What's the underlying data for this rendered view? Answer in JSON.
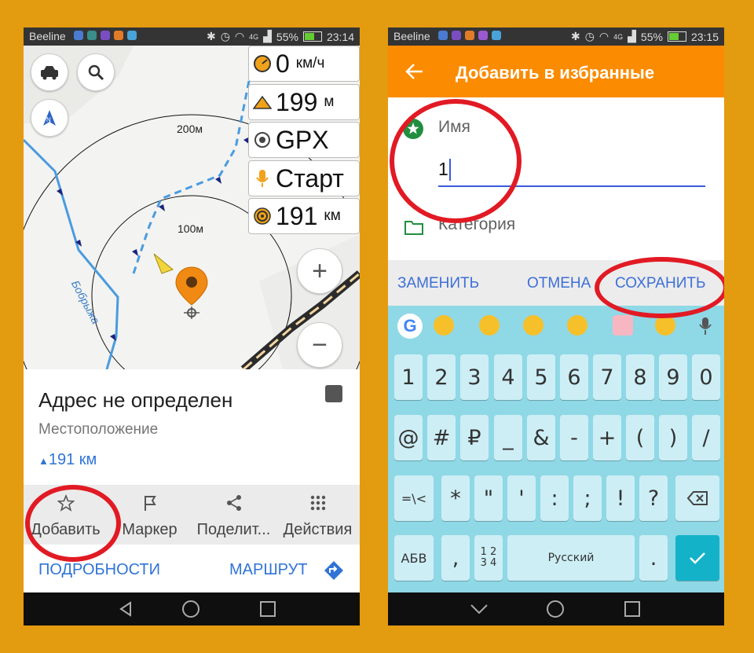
{
  "left_screen": {
    "status": {
      "carrier": "Beeline",
      "network": "4G",
      "battery": "55%",
      "time": "23:14"
    },
    "map": {
      "speed": {
        "value": "0",
        "unit": "км/ч",
        "icon": "speedometer-icon"
      },
      "altitude": {
        "value": "199",
        "unit": "м",
        "icon": "mountain-icon"
      },
      "gpx": {
        "value": "GPX",
        "icon": "record-icon"
      },
      "voice": {
        "value": "Старт",
        "icon": "microphone-icon"
      },
      "distance": {
        "value": "191",
        "unit": "км",
        "icon": "target-icon"
      },
      "scale_outer": "200м",
      "scale_inner": "100м",
      "river_label": "Бобрыжа",
      "zoom_in": "+",
      "zoom_out": "−"
    },
    "info": {
      "address": "Адрес не определен",
      "type": "Местоположение",
      "distance": "191 км"
    },
    "actions": [
      {
        "label": "Добавить",
        "icon": "star-icon"
      },
      {
        "label": "Маркер",
        "icon": "flag-icon"
      },
      {
        "label": "Поделит...",
        "icon": "share-icon"
      },
      {
        "label": "Действия",
        "icon": "grid-icon"
      }
    ],
    "details_label": "ПОДРОБНОСТИ",
    "route_label": "МАРШРУТ"
  },
  "right_screen": {
    "status": {
      "carrier": "Beeline",
      "network": "4G",
      "battery": "55%",
      "time": "23:15"
    },
    "title": "Добавить в избранные",
    "name_label": "Имя",
    "name_value": "1",
    "category_label": "Категория",
    "suggest": {
      "replace": "ЗАМЕНИТЬ",
      "cancel": "ОТМЕНА",
      "save": "СОХРАНИТЬ"
    },
    "keyboard": {
      "row1": [
        "1",
        "2",
        "3",
        "4",
        "5",
        "6",
        "7",
        "8",
        "9",
        "0"
      ],
      "row2": [
        "@",
        "#",
        "₽",
        "_",
        "&",
        "-",
        "+",
        "(",
        ")",
        "/"
      ],
      "row3": [
        "=\\<",
        "*",
        "\"",
        "'",
        ":",
        ";",
        "!",
        "?"
      ],
      "abc_key": "АБВ",
      "comma": ",",
      "numpad_key": "1 2\n3 4",
      "space": "Русский",
      "period": "."
    }
  },
  "colors": {
    "accent_orange": "#fb8b00",
    "link_blue": "#2f74d6",
    "highlight_red": "#e11a24",
    "keyboard_bg": "#8fd8e6"
  }
}
